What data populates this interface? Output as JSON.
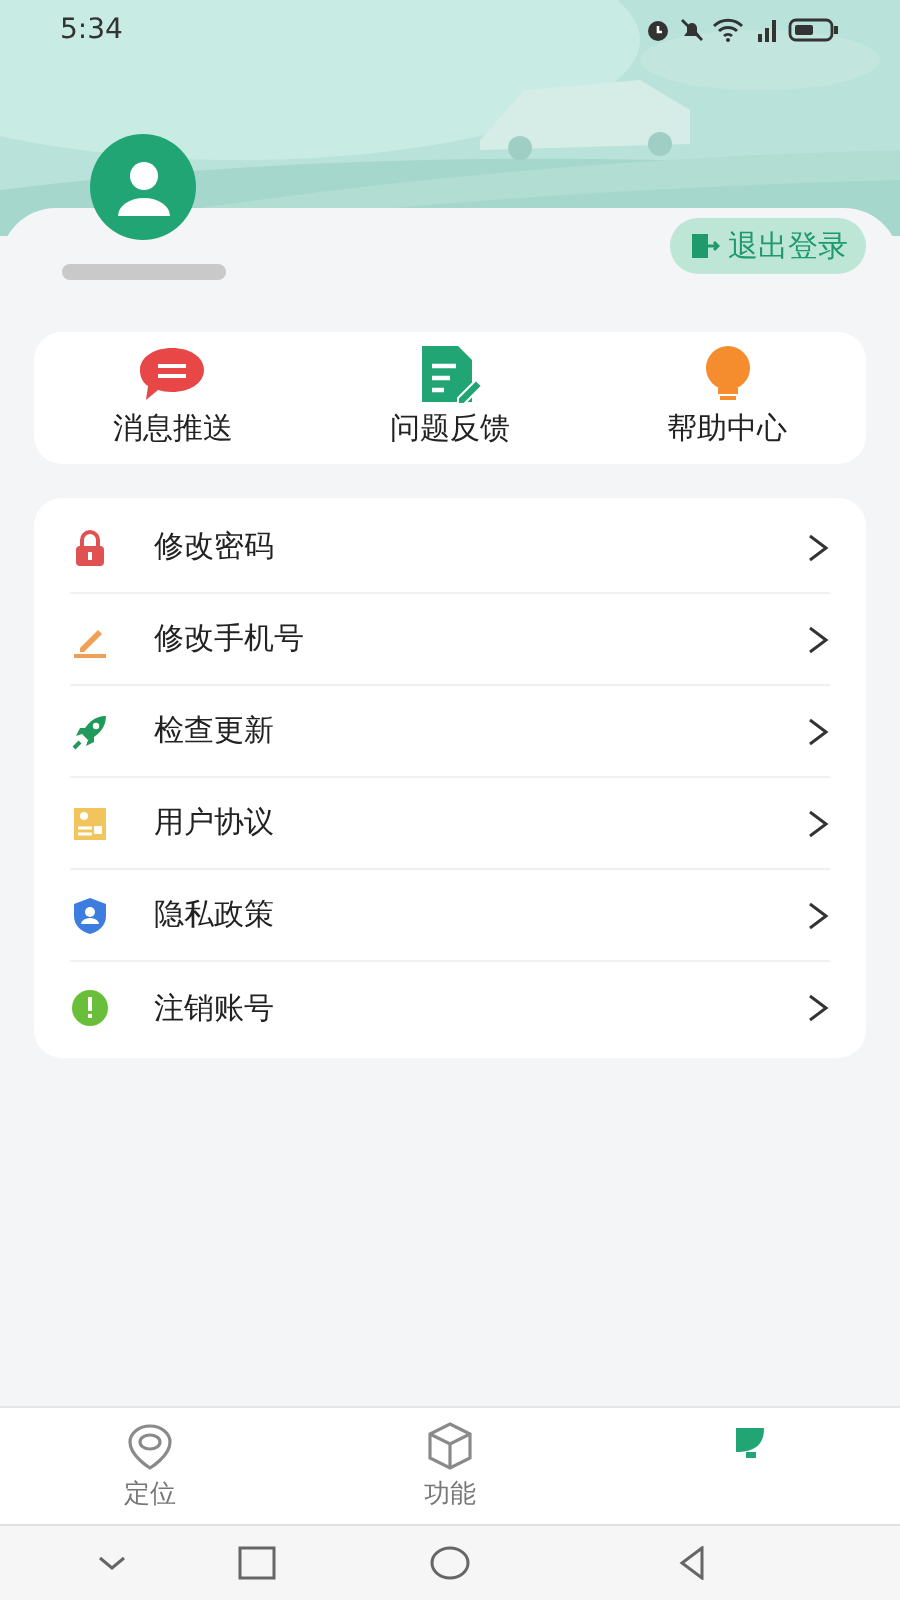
{
  "status_bar": {
    "time": "5:34"
  },
  "profile": {
    "logout_button": "退出登录"
  },
  "quick_actions": [
    {
      "label": "消息推送"
    },
    {
      "label": "问题反馈"
    },
    {
      "label": "帮助中心"
    }
  ],
  "menu": [
    {
      "label": "修改密码"
    },
    {
      "label": "修改手机号"
    },
    {
      "label": "检查更新"
    },
    {
      "label": "用户协议"
    },
    {
      "label": "隐私政策"
    },
    {
      "label": "注销账号"
    }
  ],
  "tabs": [
    {
      "label": "定位",
      "selected": false
    },
    {
      "label": "功能",
      "selected": false
    },
    {
      "selected": true
    }
  ]
}
